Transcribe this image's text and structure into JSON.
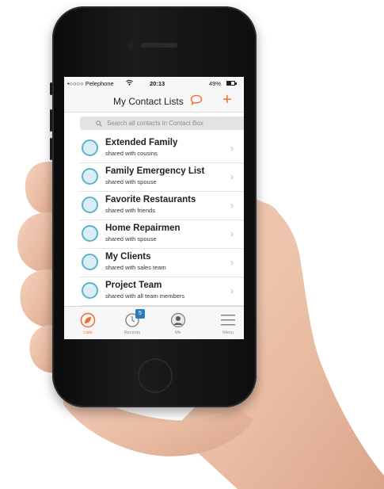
{
  "status_bar": {
    "carrier": "•○○○○ Pelephone",
    "time": "20:13",
    "battery": "49%"
  },
  "nav": {
    "title": "My Contact Lists",
    "chat_icon": "chat-bubble-icon",
    "add_icon": "plus-icon",
    "accent": "#f26a2e"
  },
  "search": {
    "placeholder": "Search all contacts in Contact Box"
  },
  "lists": [
    {
      "name": "Extended Family",
      "shared": "shared with cousins"
    },
    {
      "name": "Family Emergency List",
      "shared": "shared with spouse"
    },
    {
      "name": "Favorite Restaurants",
      "shared": "shared with friends"
    },
    {
      "name": "Home Repairmen",
      "shared": "shared with spouse"
    },
    {
      "name": "My Clients",
      "shared": "shared with sales team"
    },
    {
      "name": "Project Team",
      "shared": "shared with all team members"
    }
  ],
  "tabbar": {
    "tabs": [
      {
        "label": "Lists",
        "icon": "leaf-icon",
        "active": true
      },
      {
        "label": "Recents",
        "icon": "clock-icon",
        "badge": "5"
      },
      {
        "label": "Me",
        "icon": "person-icon"
      },
      {
        "label": "Menu",
        "icon": "hamburger-icon"
      }
    ]
  },
  "colors": {
    "accent": "#f26a2e",
    "avatar_ring": "#5bb3c9",
    "badge": "#2a7dbd"
  }
}
